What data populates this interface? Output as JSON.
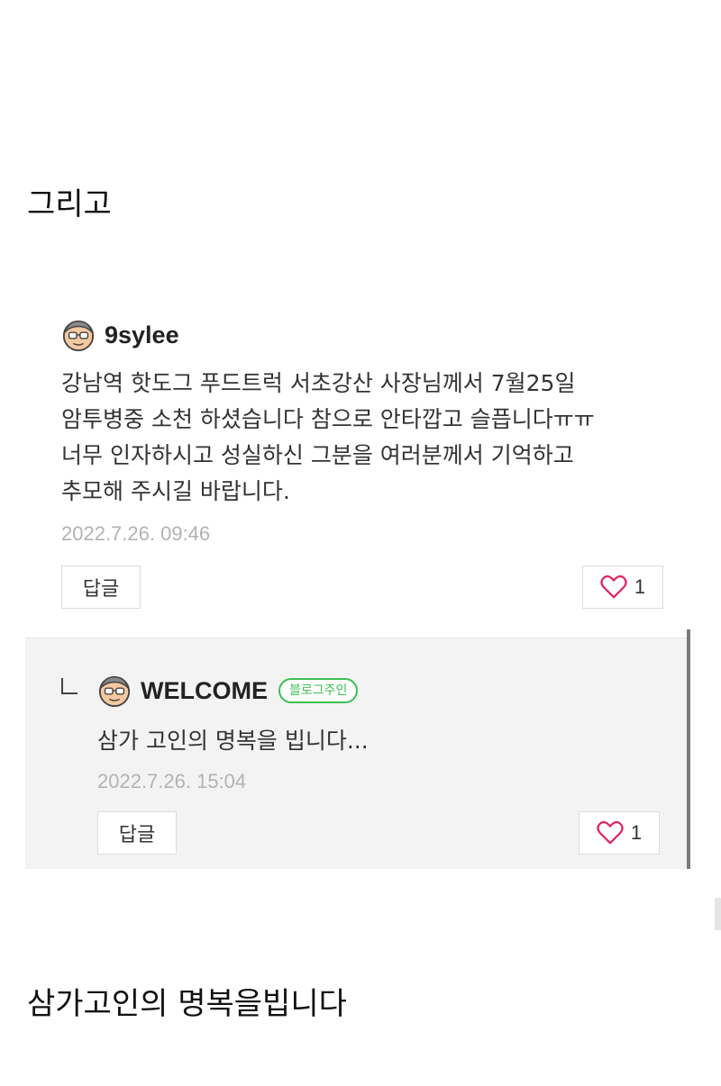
{
  "top_caption": "그리고",
  "bottom_caption": "삼가고인의 명복을빕니다",
  "comment": {
    "author": "9sylee",
    "avatar_icon": "avatar-icon",
    "text": "강남역 핫도그 푸드트럭 서초강산 사장님께서 7월25일\n암투병중 소천 하셨습니다 참으로 안타깝고 슬픕니다ㅠㅠ\n너무 인자하시고 성실하신 그분을 여러분께서 기억하고\n추모해 주시길 바랍니다.",
    "date": "2022.7.26. 09:46",
    "reply_label": "답글",
    "like_icon": "heart-icon",
    "like_count": "1"
  },
  "reply": {
    "author": "WELCOME",
    "badge": "블로그주인",
    "avatar_icon": "avatar-icon",
    "text": "삼가 고인의 명복을 빕니다...",
    "date": "2022.7.26. 15:04",
    "reply_label": "답글",
    "like_icon": "heart-icon",
    "like_count": "1"
  },
  "colors": {
    "owner_badge": "#3cbf53",
    "heart": "#e0245e",
    "date": "#b3b3b3",
    "reply_background": "#f3f3f3"
  }
}
